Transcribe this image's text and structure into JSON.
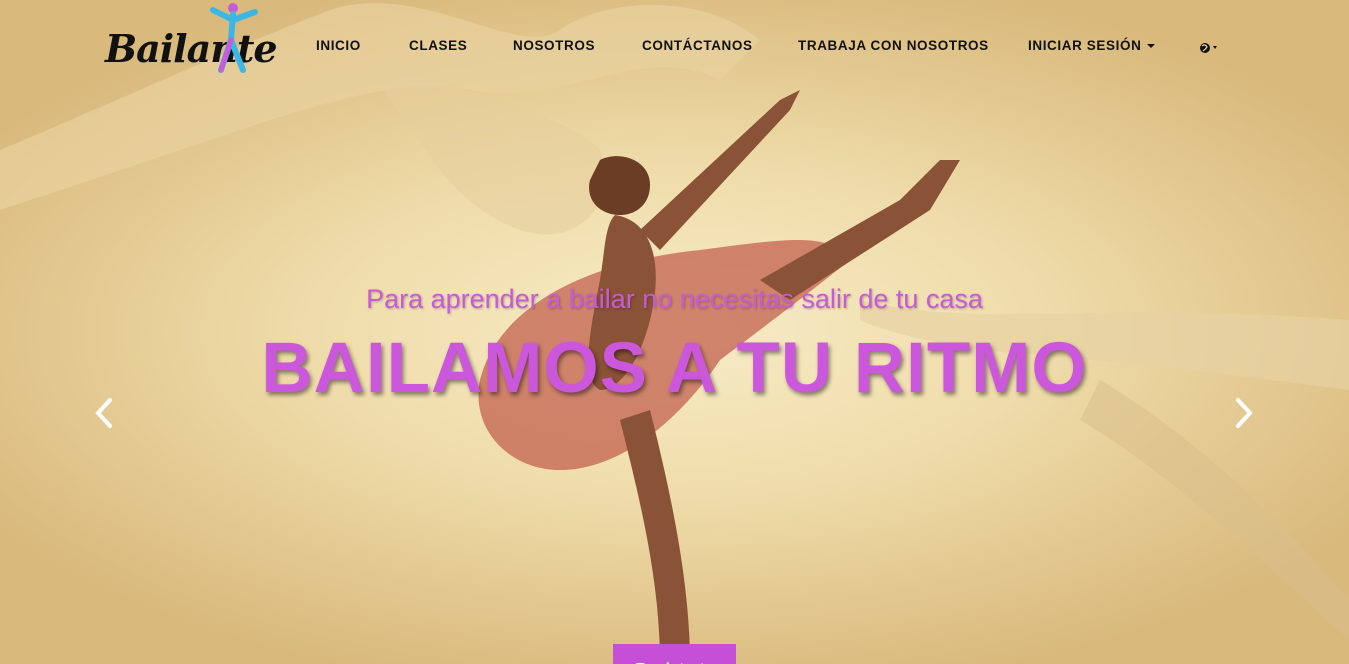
{
  "brand": {
    "name": "Bailante",
    "logo_icon": "dancer-figure-icon"
  },
  "nav": {
    "items": [
      {
        "label": "INICIO"
      },
      {
        "label": "CLASES"
      },
      {
        "label": "NOSOTROS"
      },
      {
        "label": "CONTÁCTANOS"
      },
      {
        "label": "TRABAJA CON NOSOTROS"
      },
      {
        "label": "INICIAR SESIÓN"
      }
    ],
    "language_icon": "globe-icon"
  },
  "hero": {
    "subtitle": "Para aprender a bailar no necesitas salir de tu casa",
    "headline": "BAILAMOS A TU RITMO",
    "register_label": "Registrate",
    "prev_icon": "chevron-left-icon",
    "next_icon": "chevron-right-icon"
  },
  "colors": {
    "accent": "#cb57dc",
    "text_dark": "#111111",
    "background": "#efdcaa"
  }
}
